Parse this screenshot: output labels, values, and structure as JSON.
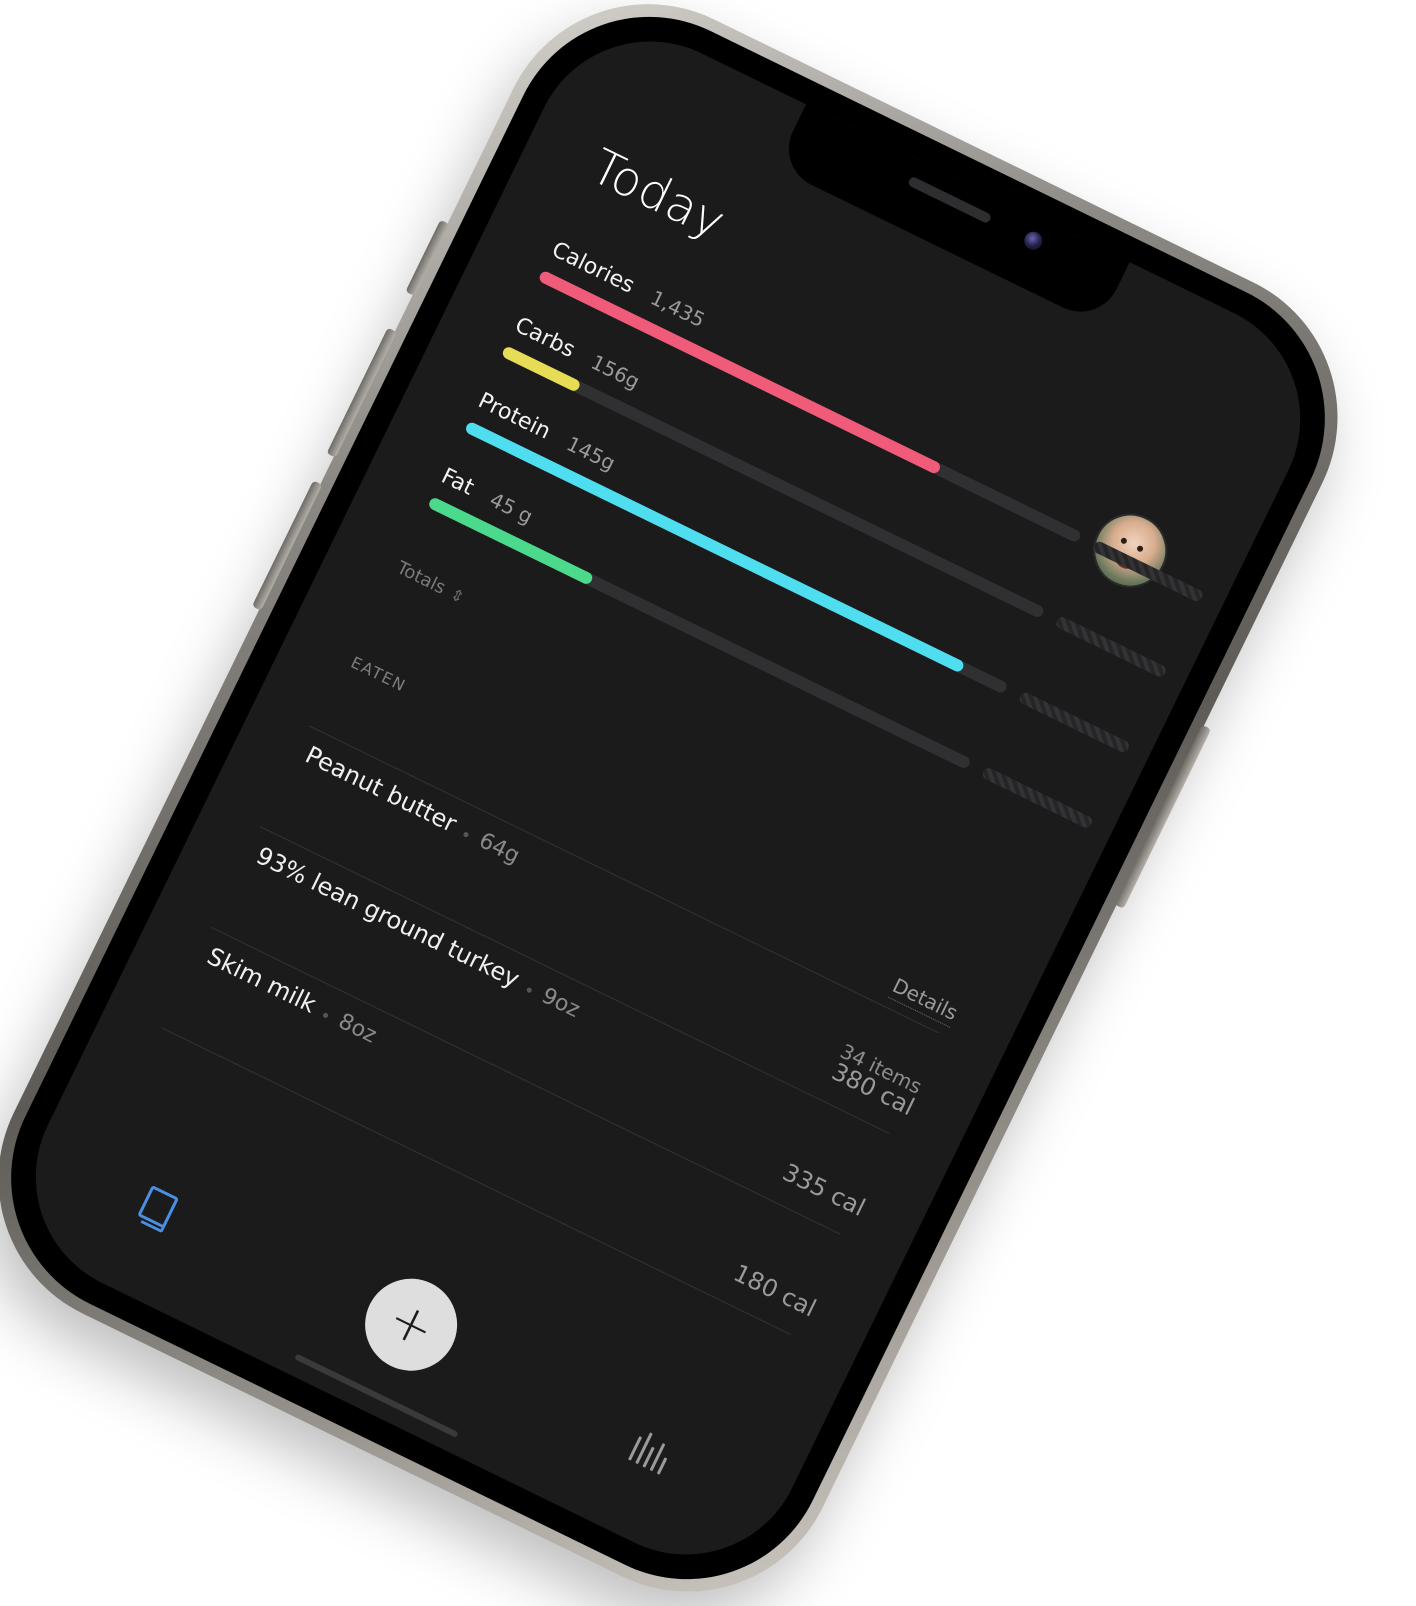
{
  "screen": {
    "title": "Today",
    "macros": [
      {
        "label": "Calories",
        "value": "1,435",
        "progress": 0.74,
        "color": "#f15b7a"
      },
      {
        "label": "Carbs",
        "value": "156g",
        "progress": 0.14,
        "color": "#e6dc55"
      },
      {
        "label": "Protein",
        "value": "145g",
        "progress": 0.92,
        "color": "#4fdef0"
      },
      {
        "label": "Fat",
        "value": "45 g",
        "progress": 0.3,
        "color": "#4bd98b"
      }
    ],
    "totals_label": "Totals",
    "eaten": {
      "header": "EATEN",
      "details_label": "Details",
      "items_count": "34 items",
      "items": [
        {
          "name": "Peanut butter",
          "qty": "64g",
          "cal": "380 cal"
        },
        {
          "name": "93% lean ground turkey",
          "qty": "9oz",
          "cal": "335 cal"
        },
        {
          "name": "Skim milk",
          "qty": "8oz",
          "cal": "180 cal"
        }
      ]
    },
    "tab_bar": {
      "add_symbol": "+",
      "book_icon": "book-icon",
      "stats_icon": "bar-chart-icon"
    }
  }
}
